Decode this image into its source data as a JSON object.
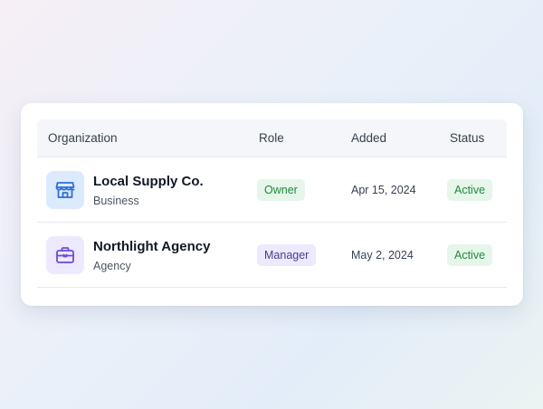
{
  "table": {
    "headers": {
      "organization": "Organization",
      "role": "Role",
      "added": "Added",
      "status": "Status"
    },
    "rows": [
      {
        "name": "Local Supply Co.",
        "type": "Business",
        "icon": "storefront-icon",
        "role": "Owner",
        "added": "Apr 15, 2024",
        "status": "Active"
      },
      {
        "name": "Northlight Agency",
        "type": "Agency",
        "icon": "briefcase-icon",
        "role": "Manager",
        "added": "May 2, 2024",
        "status": "Active"
      }
    ]
  },
  "colors": {
    "blue_icon": "#2f6fd6",
    "purple_icon": "#6d4bd8",
    "active_green": "#1e8a3c",
    "owner_green": "#1e8a3c",
    "manager_violet": "#4c3c8a"
  }
}
